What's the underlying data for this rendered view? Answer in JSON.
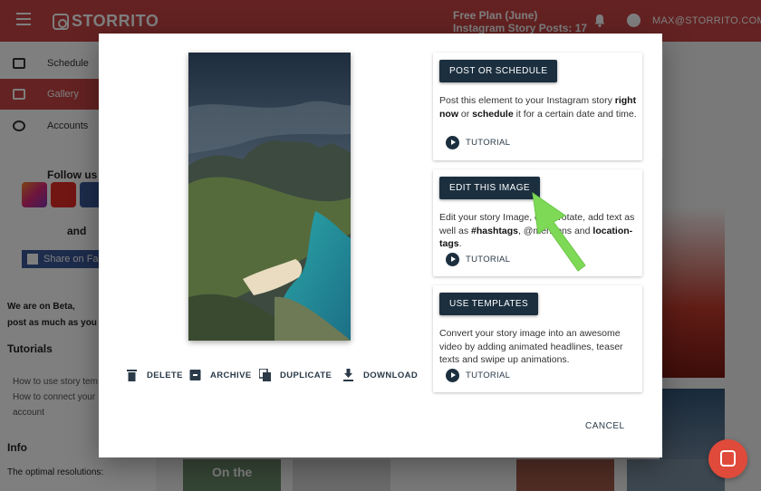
{
  "app": {
    "logo_text": "STORRITO",
    "plan_line1": "Free Plan (June)",
    "plan_line2": "Instagram Story Posts: 17",
    "email": "MAX@STORRITO.COM",
    "brand_color": "#c94444"
  },
  "sidebar": {
    "items": [
      {
        "label": "Schedule",
        "icon": "calendar-icon"
      },
      {
        "label": "Gallery",
        "icon": "gallery-icon"
      },
      {
        "label": "Accounts",
        "icon": "people-icon"
      }
    ],
    "follow_text": "Follow us o",
    "and_text": "and",
    "share_label": "Share on Fa",
    "beta_line1": "We are on Beta,",
    "beta_line2": "post as much as you li",
    "tutorials_heading": "Tutorials",
    "tutorial_link1": "How to use story tem",
    "tutorial_link2a": "How to connect your",
    "tutorial_link2b": "account",
    "info_heading": "Info",
    "info_text": "The optimal resolutions:"
  },
  "gallery": {
    "thumb_caption": "On the"
  },
  "dialog": {
    "actions": [
      {
        "label": "DELETE",
        "icon": "trash-icon"
      },
      {
        "label": "ARCHIVE",
        "icon": "archive-icon"
      },
      {
        "label": "DUPLICATE",
        "icon": "duplicate-icon"
      },
      {
        "label": "DOWNLOAD",
        "icon": "download-icon"
      }
    ],
    "panels": [
      {
        "button": "POST OR SCHEDULE",
        "desc_a": "Post this element to your Instagram story ",
        "desc_b": "right now",
        "desc_c": " or ",
        "desc_d": "schedule",
        "desc_e": " it for a certain date and time.",
        "tutorial": "TUTORIAL"
      },
      {
        "button": "EDIT THIS IMAGE",
        "desc_a": "Edit your story Image, crop, rotate, add text as well as ",
        "desc_b": "#hashtags",
        "desc_c": ", @mentions and ",
        "desc_d": "location-tags",
        "desc_e": ".",
        "tutorial": "TUTORIAL"
      },
      {
        "button": "USE TEMPLATES",
        "desc": "Convert your story image into an awesome video by adding animated headlines, teaser texts and swipe up animations.",
        "tutorial": "TUTORIAL"
      }
    ],
    "cancel": "CANCEL",
    "accent_arrow_color": "#7ed957"
  }
}
